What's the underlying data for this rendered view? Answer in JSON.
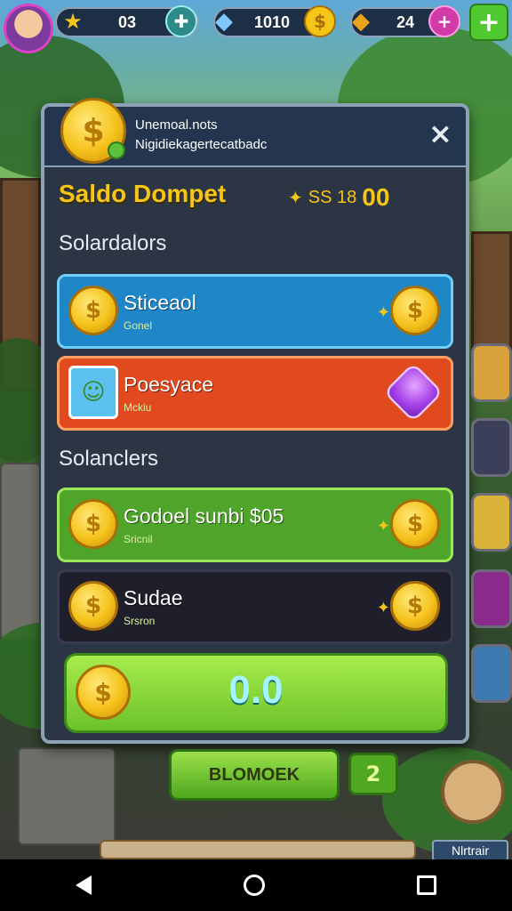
{
  "hud": {
    "stars": "03",
    "energy": "1010",
    "gems": "24",
    "avatar_icon": "player-avatar",
    "add_icon": "plus-icon"
  },
  "modal": {
    "header_line1": "Unemoal.nots",
    "header_line2": "Nigidiekagertecatbadc",
    "close": "×",
    "wallet_title": "Saldo Dompet",
    "wallet_value_small": "SS 18",
    "wallet_value_big": "00",
    "section1": "Solardalors",
    "section2": "Solanclers",
    "rows": [
      {
        "title": "Sticeaol",
        "sub": "Gonel"
      },
      {
        "title": "Poesyace",
        "sub": "Mckiu"
      },
      {
        "title": "Godoel sunbi $05",
        "sub": "Sricnil"
      },
      {
        "title": "Sudae",
        "sub": "Srsron"
      }
    ],
    "big_value": "0.0"
  },
  "bottom": {
    "button": "BLOMOEK",
    "count": "2",
    "menu_tag": "Nlrtrair"
  },
  "colors": {
    "blue_row": "#1f86c8",
    "red_row": "#e1491f",
    "green_row": "#4ea52a",
    "dark_row": "#1f1f2c",
    "gold": "#f5c518"
  }
}
